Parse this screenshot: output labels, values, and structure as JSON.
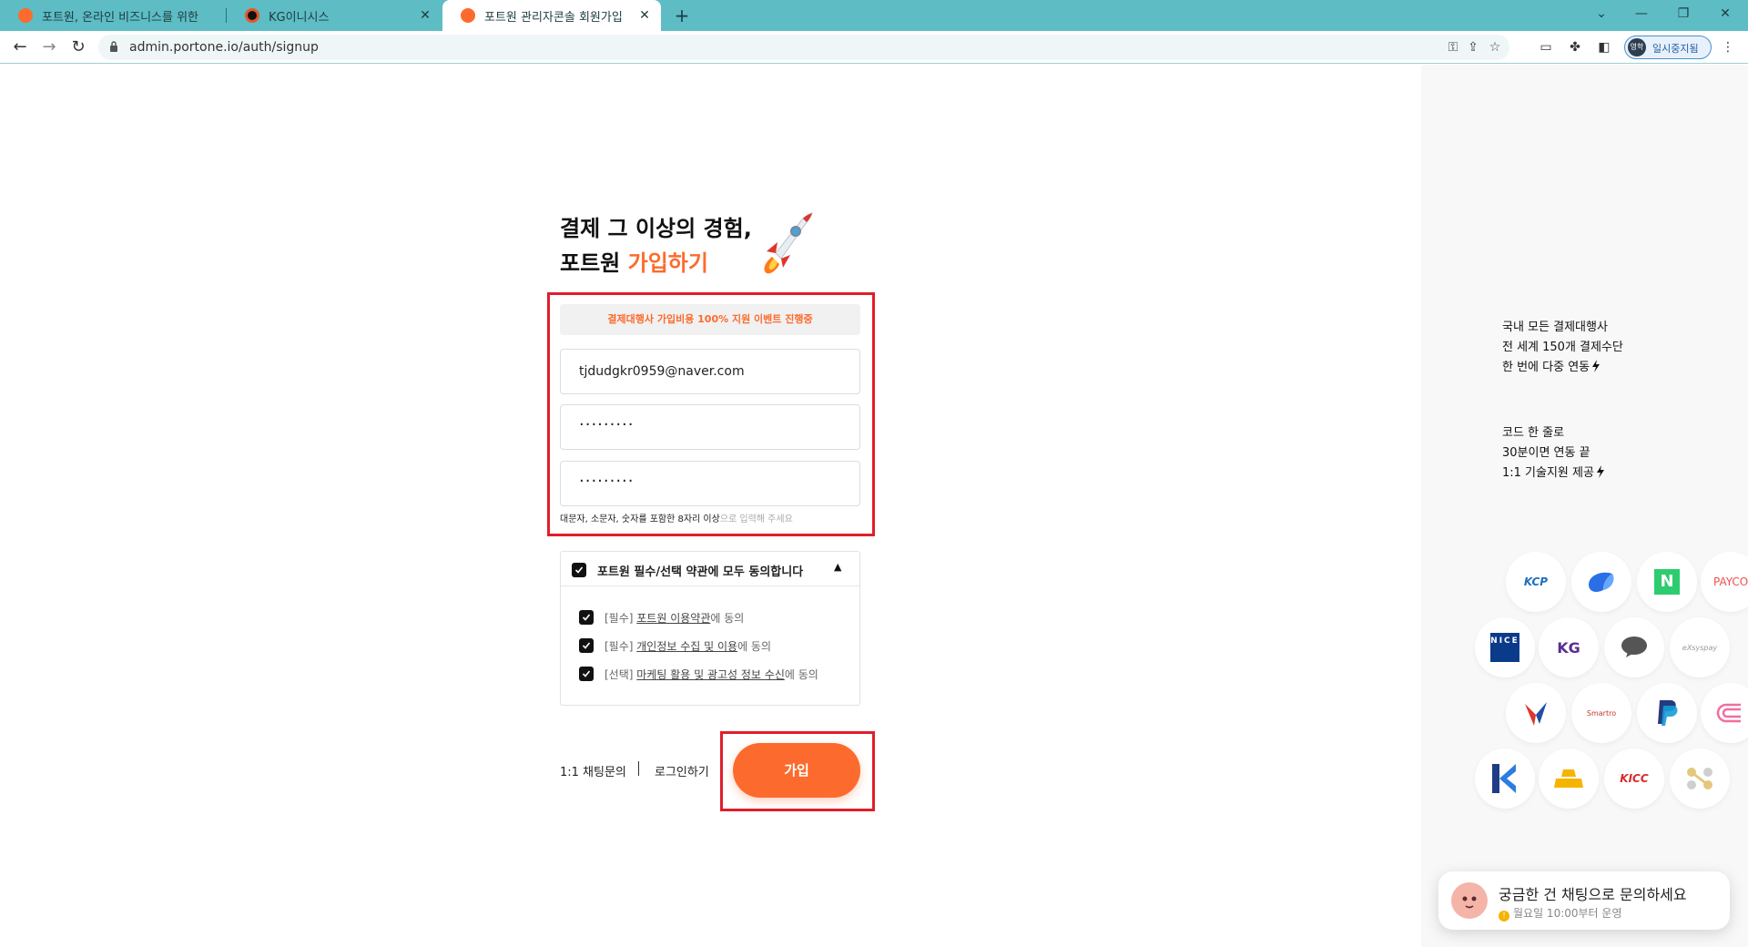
{
  "browser": {
    "tabs": [
      {
        "title": "포트원, 온라인 비즈니스를 위한",
        "active": false
      },
      {
        "title": "KG이니시스",
        "active": false
      },
      {
        "title": "포트원 관리자콘솔 회원가입",
        "active": true
      }
    ],
    "url": "admin.portone.io/auth/signup",
    "profile_avatar": "영학",
    "profile_label": "일시중지됨"
  },
  "signup": {
    "heading_line1": "결제 그 이상의 경험,",
    "heading_line2_prefix": "포트원 ",
    "heading_line2_accent": "가입하기",
    "promo_banner": "결제대행사 가입비용 100% 지원 이벤트 진행중",
    "email_value": "tjdudgkr0959@naver.com",
    "password_value": "·········",
    "password_confirm_value": "·········",
    "password_hint_main": "대문자, 소문자, 숫자를 포함한 8자리 이상",
    "password_hint_suffix": "으로 입력해 주세요",
    "terms": {
      "all_agree": "포트원 필수/선택 약관에 모두 동의합니다",
      "items": [
        {
          "prefix": "[필수] ",
          "link": "포트원 이용약관",
          "suffix": "에 동의",
          "checked": true
        },
        {
          "prefix": "[필수] ",
          "link": "개인정보 수집 및 이용",
          "suffix": "에 동의",
          "checked": true
        },
        {
          "prefix": "[선택] ",
          "link": "마케팅 활용 및 광고성 정보 수신",
          "suffix": "에 동의",
          "checked": true
        }
      ]
    },
    "chat_inquiry": "1:1 채팅문의",
    "login": "로그인하기",
    "join_button": "가입"
  },
  "features": {
    "block1": [
      "국내 모든 결제대행사",
      "전 세계 150개 결제수단",
      "한 번에 다중 연동"
    ],
    "block2": [
      "코드 한 줄로",
      "30분이면 연동 끝",
      "1:1 기술지원 제공"
    ]
  },
  "pg_logos": {
    "kcp": "KCP",
    "payco": "PAYCO",
    "nice": "NICE",
    "kg": "KG",
    "exsyspay": "eXsyspay",
    "smartro": "Smartro",
    "kicc": "KICC"
  },
  "chat_widget": {
    "title": "궁금한 건 채팅으로 문의하세요",
    "subtitle": "월요일 10:00부터 운영"
  },
  "colors": {
    "accent": "#fc6b2d",
    "highlight": "#e01e2b",
    "tabbar": "#5dbcc4"
  }
}
